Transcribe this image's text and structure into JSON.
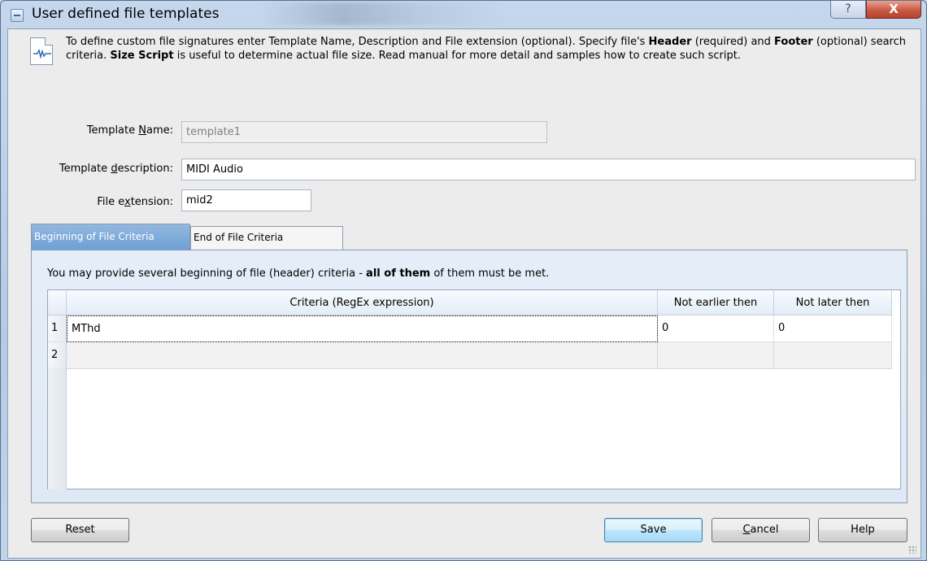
{
  "window": {
    "title": "User defined file templates",
    "help_glyph": "?",
    "close_glyph": "X"
  },
  "info": {
    "intro": "To define custom file signatures enter Template Name, Description and File extension (optional). Specify file's ",
    "header_bold": "Header",
    "mid1": " (required) and ",
    "footer_bold": "Footer",
    "mid2": " (optional) search criteria. ",
    "size_bold": "Size Script",
    "tail": " is useful to determine actual file size. Read manual for more detail and samples how to create such script."
  },
  "fields": {
    "template_name": {
      "label_pre": "Template ",
      "label_u": "N",
      "label_post": "ame:",
      "value": "template1"
    },
    "template_description": {
      "label_pre": "Template ",
      "label_u": "d",
      "label_post": "escription:",
      "value": "MIDI Audio"
    },
    "file_extension": {
      "label_pre": "File e",
      "label_u": "x",
      "label_post": "tension:",
      "value": "mid2"
    }
  },
  "tabs": [
    {
      "label": "Beginning of File Criteria",
      "active": true
    },
    {
      "label": "End of File Criteria",
      "active": false
    }
  ],
  "panel": {
    "text_pre": "You may provide several beginning of file (header) criteria - ",
    "text_bold": "all of them",
    "text_post": " of them must be met."
  },
  "grid": {
    "columns": [
      "Criteria (RegEx expression)",
      "Not earlier then",
      "Not later then"
    ],
    "rows": [
      {
        "num": "1",
        "criteria": "MThd",
        "not_earlier": "0",
        "not_later": "0"
      },
      {
        "num": "2",
        "criteria": "",
        "not_earlier": "",
        "not_later": ""
      }
    ]
  },
  "buttons": {
    "reset": "Reset",
    "save": "Save",
    "cancel_u": "C",
    "cancel_rest": "ancel",
    "help": "Help"
  }
}
